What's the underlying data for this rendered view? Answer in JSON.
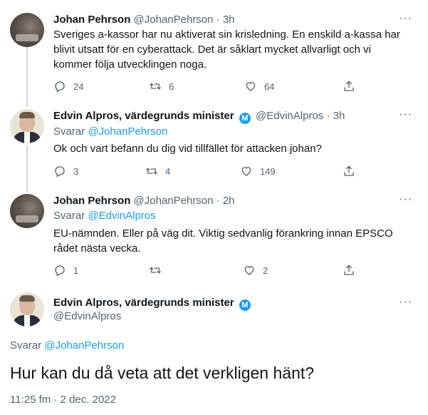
{
  "tweets": [
    {
      "name": "Johan Pehrson",
      "handle": "@JohanPehrson",
      "time": "· 3h",
      "text": "Sveriges a-kassor har nu aktiverat sin krisledning. En enskild a-kassa har blivit utsatt för en cyberattack. Det är såklart mycket allvarligt och vi kommer följa utvecklingen noga.",
      "replies": "24",
      "retweets": "6",
      "likes": "64"
    },
    {
      "name": "Edvin Alpros, värdegrunds minister",
      "handle": "@EdvinAlpros",
      "time": "· 3h",
      "replying_label": "Svarar",
      "replying_to": "@JohanPehrson",
      "text": "Ok och vart befann du dig vid tillfället för attacken johan?",
      "replies": "3",
      "retweets": "4",
      "likes": "149"
    },
    {
      "name": "Johan Pehrson",
      "handle": "@JohanPehrson",
      "time": "· 2h",
      "replying_label": "Svarar",
      "replying_to": "@EdvinAlpros",
      "text": "EU-nämnden. Eller på väg dit. Viktig sedvanlig förankring innan EPSCO rådet nästa vecka.",
      "replies": "1",
      "retweets": "",
      "likes": "2"
    }
  ],
  "focused": {
    "name": "Edvin Alpros, värdegrunds minister",
    "handle": "@EdvinAlpros",
    "replying_label": "Svarar",
    "replying_to": "@JohanPehrson",
    "text": "Hur kan du då veta att det verkligen hänt?",
    "timestamp": "11:25 fm · 2 dec. 2022"
  },
  "more_label": "···",
  "verified_badge": "M",
  "colors": {
    "accent": "#1d9bf0",
    "text": "#0f1419",
    "secondary": "#536471",
    "thread_line": "#cfd9de"
  }
}
